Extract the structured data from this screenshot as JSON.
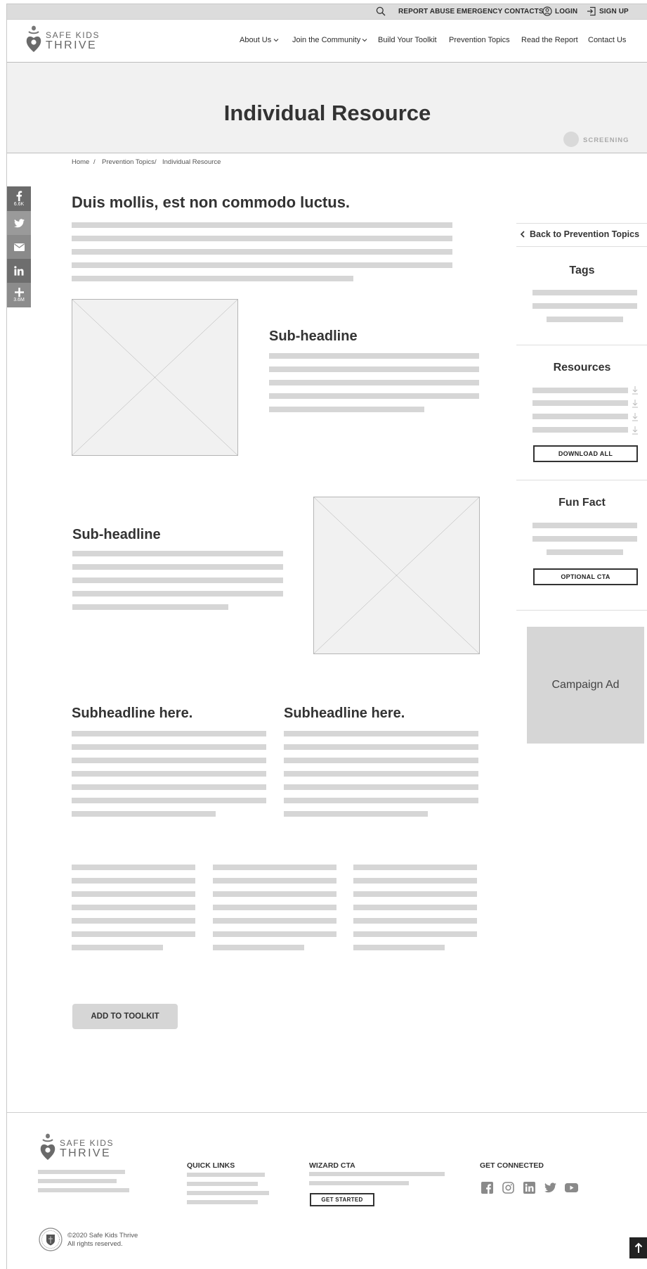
{
  "utility_bar": {
    "report_abuse": "REPORT ABUSE",
    "emergency_contacts": "EMERGENCY CONTACTS",
    "login": "LOGIN",
    "signup": "SIGN UP"
  },
  "brand": {
    "line1": "SAFE KIDS",
    "line2": "THRIVE"
  },
  "nav": {
    "items": [
      {
        "label": "About Us",
        "icon": "chevron-down-icon"
      },
      {
        "label": "Join the Community",
        "icon": "chevron-down-icon"
      },
      {
        "label": "Build Your Toolkit"
      },
      {
        "label": "Prevention Topics"
      },
      {
        "label": "Read the Report"
      },
      {
        "label": "Contact Us"
      }
    ]
  },
  "hero": {
    "title": "Individual Resource",
    "tag": "SCREENING"
  },
  "breadcrumb": {
    "home": "Home",
    "sep": "/",
    "topics": "Prevention Topics",
    "current": "Individual Resource"
  },
  "share": {
    "facebook_count": "6.6K",
    "more_count": "3.6M"
  },
  "main": {
    "headline": "Duis mollis, est non commodo luctus.",
    "section1_subheadline": "Sub-headline",
    "section2_subheadline": "Sub-headline",
    "col1_subheadline": "Subheadline here.",
    "col2_subheadline": "Subheadline here.",
    "add_to_toolkit": "ADD TO TOOLKIT"
  },
  "sidebar": {
    "back_link": "Back to Prevention Topics",
    "tags_title": "Tags",
    "resources_title": "Resources",
    "download_all": "DOWNLOAD ALL",
    "fun_fact_title": "Fun Fact",
    "optional_cta": "OPTIONAL CTA",
    "campaign_ad": "Campaign Ad"
  },
  "footer": {
    "quick_links_title": "QUICK LINKS",
    "wizard_title": "WIZARD CTA",
    "get_started": "GET STARTED",
    "connected_title": "GET CONNECTED",
    "copyright": "©2020 Safe Kids Thrive",
    "rights": "All rights reserved."
  },
  "colors": {
    "placeholder_bar": "#d6d6d6",
    "hero_bg": "#f1f1f1",
    "share_facebook": "#6b6b6b",
    "share_twitter": "#9a9a9a",
    "share_email": "#8a8a8a",
    "share_linkedin": "#6e6e6e",
    "share_more": "#8c8c8c",
    "text_dark": "#333333"
  },
  "icons": [
    "search-icon",
    "user-circle-icon",
    "sign-in-icon",
    "logo-heart-icon",
    "chevron-down-icon",
    "facebook-icon",
    "twitter-icon",
    "email-icon",
    "linkedin-icon",
    "plus-icon",
    "chevron-left-icon",
    "download-icon",
    "instagram-icon",
    "youtube-icon",
    "arrow-up-icon",
    "state-seal-icon"
  ]
}
